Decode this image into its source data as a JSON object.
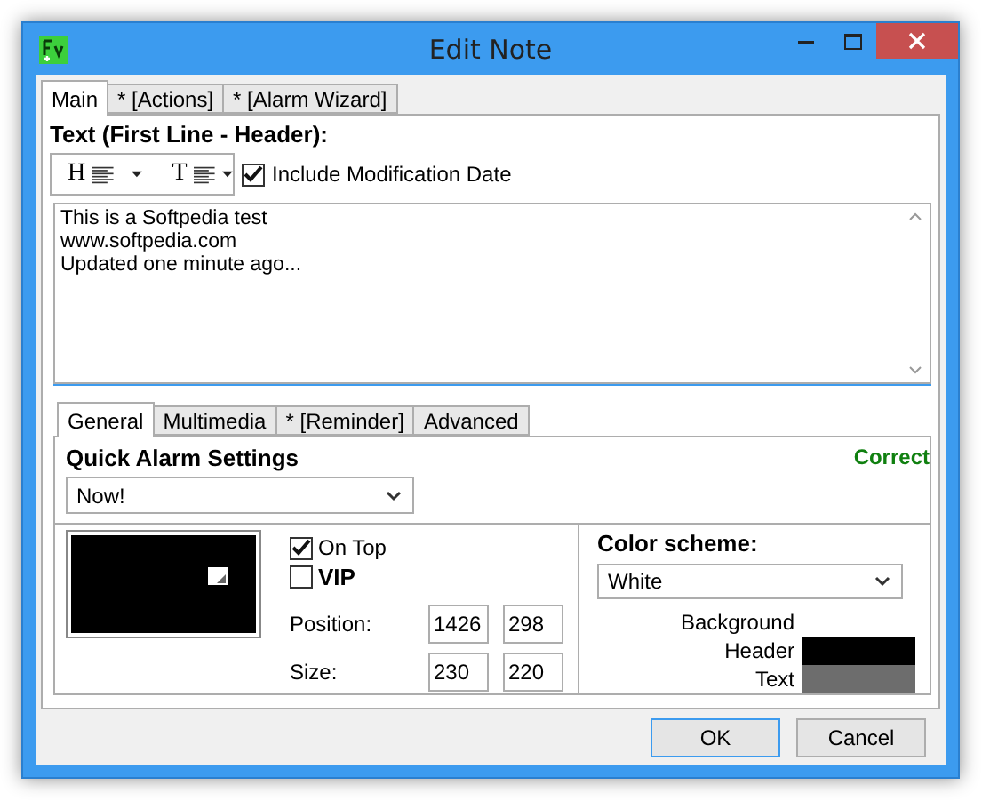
{
  "window": {
    "title": "Edit Note"
  },
  "main_tabs": [
    {
      "label": "Main",
      "selected": true
    },
    {
      "label": "* [Actions]",
      "selected": false
    },
    {
      "label": "* [Alarm Wizard]",
      "selected": false
    }
  ],
  "text_section": {
    "label": "Text (First Line - Header):",
    "header_format": "H",
    "text_format": "T",
    "include_date": {
      "label": "Include Modification Date",
      "checked": true
    },
    "note_lines": [
      "This is a Softpedia test",
      "www.softpedia.com",
      "Updated one minute ago..."
    ]
  },
  "sub_tabs": [
    {
      "label": "General",
      "selected": true
    },
    {
      "label": "Multimedia",
      "selected": false
    },
    {
      "label": "* [Reminder]",
      "selected": false
    },
    {
      "label": "Advanced",
      "selected": false
    }
  ],
  "quick_alarm": {
    "label": "Quick Alarm Settings",
    "status": "Correct",
    "value": "Now!"
  },
  "options": [
    {
      "label": "On Top",
      "checked": true,
      "emphasis": false
    },
    {
      "label": "VIP",
      "checked": false,
      "emphasis": true
    }
  ],
  "coordinates": [
    {
      "label": "Position:",
      "first": "1426",
      "second": "298"
    },
    {
      "label": "Size:",
      "first": "230",
      "second": "220"
    }
  ],
  "color_scheme": {
    "label": "Color scheme:",
    "value": "White",
    "items": [
      {
        "label": "Background"
      },
      {
        "label": "Header",
        "color": "#000000"
      },
      {
        "label": "Text",
        "color": "#6d6d6d"
      }
    ]
  },
  "buttons": [
    {
      "label": "OK",
      "default": true
    },
    {
      "label": "Cancel",
      "default": false
    }
  ]
}
